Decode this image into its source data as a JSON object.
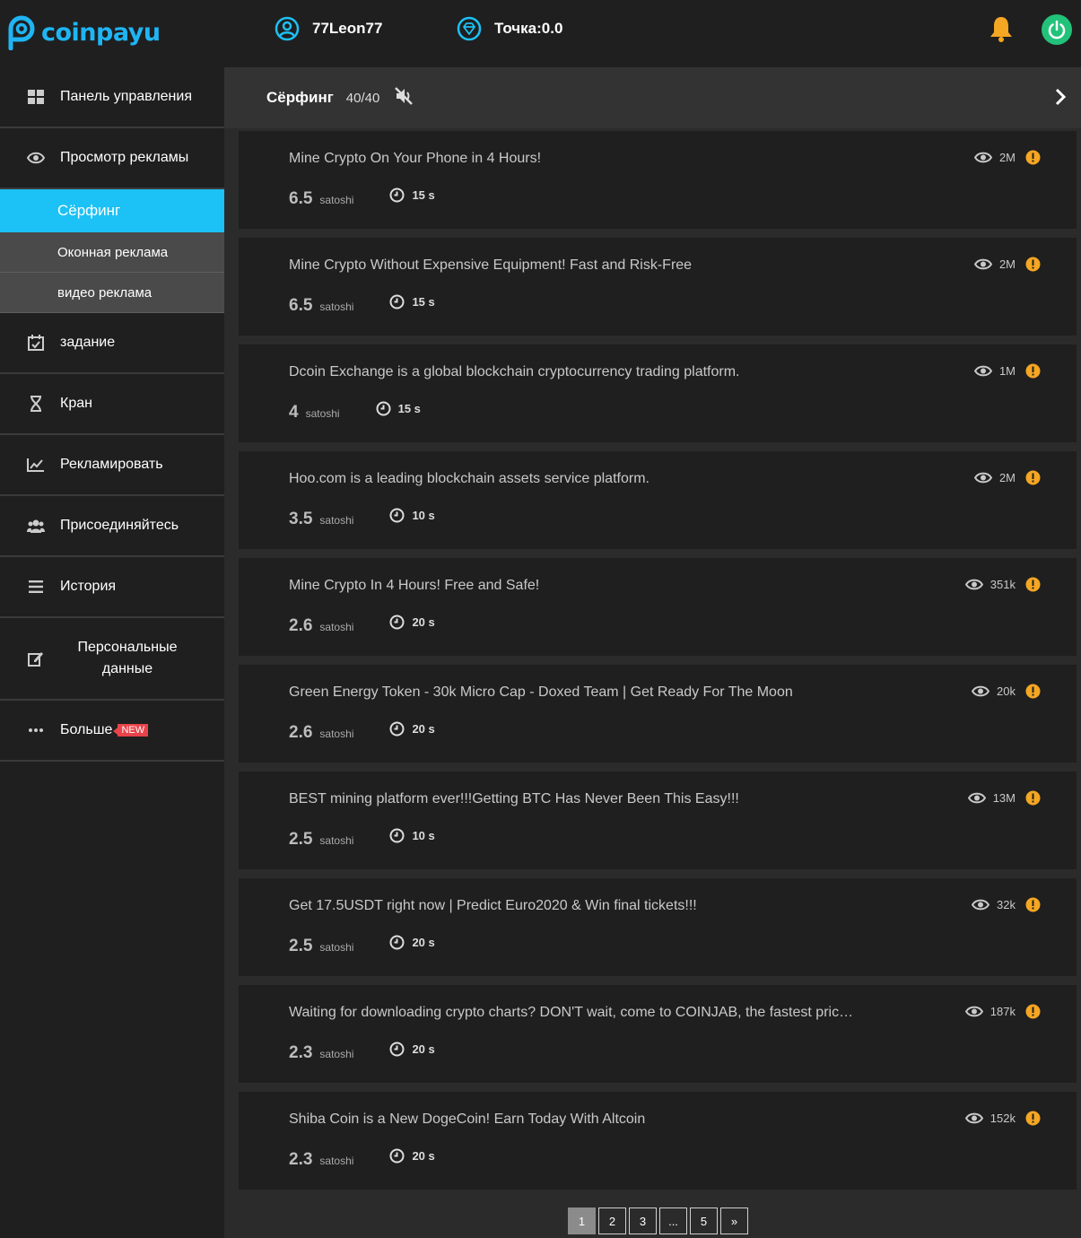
{
  "header": {
    "logo_text": "coinpayu",
    "username": "77Leon77",
    "points_label": "Точка:0.0"
  },
  "sidebar": {
    "items": [
      {
        "label": "Панель управления",
        "icon": "dashboard-grid-icon"
      },
      {
        "label": "Просмотр рекламы",
        "icon": "eye-icon"
      },
      {
        "label": "задание",
        "icon": "calendar-check-icon"
      },
      {
        "label": "Кран",
        "icon": "hourglass-icon"
      },
      {
        "label": "Рекламировать",
        "icon": "chart-line-icon"
      },
      {
        "label": "Присоединяйтесь",
        "icon": "users-icon"
      },
      {
        "label": "История",
        "icon": "list-icon"
      },
      {
        "label": "Персональные данные",
        "icon": "edit-icon"
      },
      {
        "label": "Больше",
        "icon": "more-dots-icon",
        "badge": "NEW"
      }
    ],
    "subitems": [
      {
        "label": "Сёрфинг",
        "active": true
      },
      {
        "label": "Оконная реклама"
      },
      {
        "label": "видео реклама"
      }
    ]
  },
  "section": {
    "title": "Сёрфинг",
    "count": "40/40"
  },
  "ads": [
    {
      "title": "Mine Crypto On Your Phone in 4 Hours!",
      "reward": "6.5",
      "unit": "satoshi",
      "duration": "15 s",
      "views": "2M"
    },
    {
      "title": "Mine Crypto Without Expensive Equipment! Fast and Risk-Free",
      "reward": "6.5",
      "unit": "satoshi",
      "duration": "15 s",
      "views": "2M"
    },
    {
      "title": "Dcoin Exchange is a global blockchain cryptocurrency trading platform.",
      "reward": "4",
      "unit": "satoshi",
      "duration": "15 s",
      "views": "1M"
    },
    {
      "title": "Hoo.com is a leading blockchain assets service platform.",
      "reward": "3.5",
      "unit": "satoshi",
      "duration": "10 s",
      "views": "2M"
    },
    {
      "title": "Mine Crypto In 4 Hours! Free and Safe!",
      "reward": "2.6",
      "unit": "satoshi",
      "duration": "20 s",
      "views": "351k"
    },
    {
      "title": "Green Energy Token - 30k Micro Cap - Doxed Team | Get Ready For The Moon",
      "reward": "2.6",
      "unit": "satoshi",
      "duration": "20 s",
      "views": "20k"
    },
    {
      "title": "BEST mining platform ever!!!Getting BTC Has Never Been This Easy!!!",
      "reward": "2.5",
      "unit": "satoshi",
      "duration": "10 s",
      "views": "13M"
    },
    {
      "title": "Get 17.5USDT right now | Predict Euro2020 & Win final tickets!!!",
      "reward": "2.5",
      "unit": "satoshi",
      "duration": "20 s",
      "views": "32k"
    },
    {
      "title": "Waiting for downloading crypto charts? DON'T wait, come to COINJAB, the fastest pric…",
      "reward": "2.3",
      "unit": "satoshi",
      "duration": "20 s",
      "views": "187k"
    },
    {
      "title": "Shiba Coin is a New DogeCoin! Earn Today With Altcoin",
      "reward": "2.3",
      "unit": "satoshi",
      "duration": "20 s",
      "views": "152k"
    }
  ],
  "pagination": [
    "1",
    "2",
    "3",
    "...",
    "5",
    "»"
  ],
  "colors": {
    "accent": "#1cc1f5",
    "warn": "#f5a623",
    "power": "#22c27a"
  }
}
